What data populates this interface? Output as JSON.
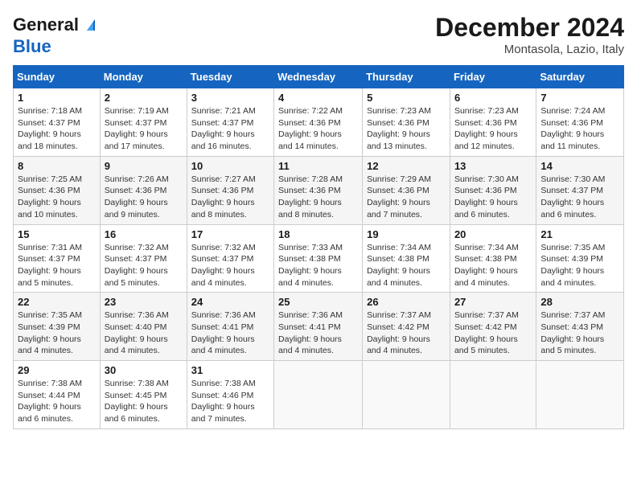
{
  "header": {
    "logo_general": "General",
    "logo_blue": "Blue",
    "month_title": "December 2024",
    "location": "Montasola, Lazio, Italy"
  },
  "days_of_week": [
    "Sunday",
    "Monday",
    "Tuesday",
    "Wednesday",
    "Thursday",
    "Friday",
    "Saturday"
  ],
  "weeks": [
    [
      {
        "day": "1",
        "sunrise": "7:18 AM",
        "sunset": "4:37 PM",
        "daylight": "9 hours and 18 minutes."
      },
      {
        "day": "2",
        "sunrise": "7:19 AM",
        "sunset": "4:37 PM",
        "daylight": "9 hours and 17 minutes."
      },
      {
        "day": "3",
        "sunrise": "7:21 AM",
        "sunset": "4:37 PM",
        "daylight": "9 hours and 16 minutes."
      },
      {
        "day": "4",
        "sunrise": "7:22 AM",
        "sunset": "4:36 PM",
        "daylight": "9 hours and 14 minutes."
      },
      {
        "day": "5",
        "sunrise": "7:23 AM",
        "sunset": "4:36 PM",
        "daylight": "9 hours and 13 minutes."
      },
      {
        "day": "6",
        "sunrise": "7:23 AM",
        "sunset": "4:36 PM",
        "daylight": "9 hours and 12 minutes."
      },
      {
        "day": "7",
        "sunrise": "7:24 AM",
        "sunset": "4:36 PM",
        "daylight": "9 hours and 11 minutes."
      }
    ],
    [
      {
        "day": "8",
        "sunrise": "7:25 AM",
        "sunset": "4:36 PM",
        "daylight": "9 hours and 10 minutes."
      },
      {
        "day": "9",
        "sunrise": "7:26 AM",
        "sunset": "4:36 PM",
        "daylight": "9 hours and 9 minutes."
      },
      {
        "day": "10",
        "sunrise": "7:27 AM",
        "sunset": "4:36 PM",
        "daylight": "9 hours and 8 minutes."
      },
      {
        "day": "11",
        "sunrise": "7:28 AM",
        "sunset": "4:36 PM",
        "daylight": "9 hours and 8 minutes."
      },
      {
        "day": "12",
        "sunrise": "7:29 AM",
        "sunset": "4:36 PM",
        "daylight": "9 hours and 7 minutes."
      },
      {
        "day": "13",
        "sunrise": "7:30 AM",
        "sunset": "4:36 PM",
        "daylight": "9 hours and 6 minutes."
      },
      {
        "day": "14",
        "sunrise": "7:30 AM",
        "sunset": "4:37 PM",
        "daylight": "9 hours and 6 minutes."
      }
    ],
    [
      {
        "day": "15",
        "sunrise": "7:31 AM",
        "sunset": "4:37 PM",
        "daylight": "9 hours and 5 minutes."
      },
      {
        "day": "16",
        "sunrise": "7:32 AM",
        "sunset": "4:37 PM",
        "daylight": "9 hours and 5 minutes."
      },
      {
        "day": "17",
        "sunrise": "7:32 AM",
        "sunset": "4:37 PM",
        "daylight": "9 hours and 4 minutes."
      },
      {
        "day": "18",
        "sunrise": "7:33 AM",
        "sunset": "4:38 PM",
        "daylight": "9 hours and 4 minutes."
      },
      {
        "day": "19",
        "sunrise": "7:34 AM",
        "sunset": "4:38 PM",
        "daylight": "9 hours and 4 minutes."
      },
      {
        "day": "20",
        "sunrise": "7:34 AM",
        "sunset": "4:38 PM",
        "daylight": "9 hours and 4 minutes."
      },
      {
        "day": "21",
        "sunrise": "7:35 AM",
        "sunset": "4:39 PM",
        "daylight": "9 hours and 4 minutes."
      }
    ],
    [
      {
        "day": "22",
        "sunrise": "7:35 AM",
        "sunset": "4:39 PM",
        "daylight": "9 hours and 4 minutes."
      },
      {
        "day": "23",
        "sunrise": "7:36 AM",
        "sunset": "4:40 PM",
        "daylight": "9 hours and 4 minutes."
      },
      {
        "day": "24",
        "sunrise": "7:36 AM",
        "sunset": "4:41 PM",
        "daylight": "9 hours and 4 minutes."
      },
      {
        "day": "25",
        "sunrise": "7:36 AM",
        "sunset": "4:41 PM",
        "daylight": "9 hours and 4 minutes."
      },
      {
        "day": "26",
        "sunrise": "7:37 AM",
        "sunset": "4:42 PM",
        "daylight": "9 hours and 4 minutes."
      },
      {
        "day": "27",
        "sunrise": "7:37 AM",
        "sunset": "4:42 PM",
        "daylight": "9 hours and 5 minutes."
      },
      {
        "day": "28",
        "sunrise": "7:37 AM",
        "sunset": "4:43 PM",
        "daylight": "9 hours and 5 minutes."
      }
    ],
    [
      {
        "day": "29",
        "sunrise": "7:38 AM",
        "sunset": "4:44 PM",
        "daylight": "9 hours and 6 minutes."
      },
      {
        "day": "30",
        "sunrise": "7:38 AM",
        "sunset": "4:45 PM",
        "daylight": "9 hours and 6 minutes."
      },
      {
        "day": "31",
        "sunrise": "7:38 AM",
        "sunset": "4:46 PM",
        "daylight": "9 hours and 7 minutes."
      },
      null,
      null,
      null,
      null
    ]
  ]
}
